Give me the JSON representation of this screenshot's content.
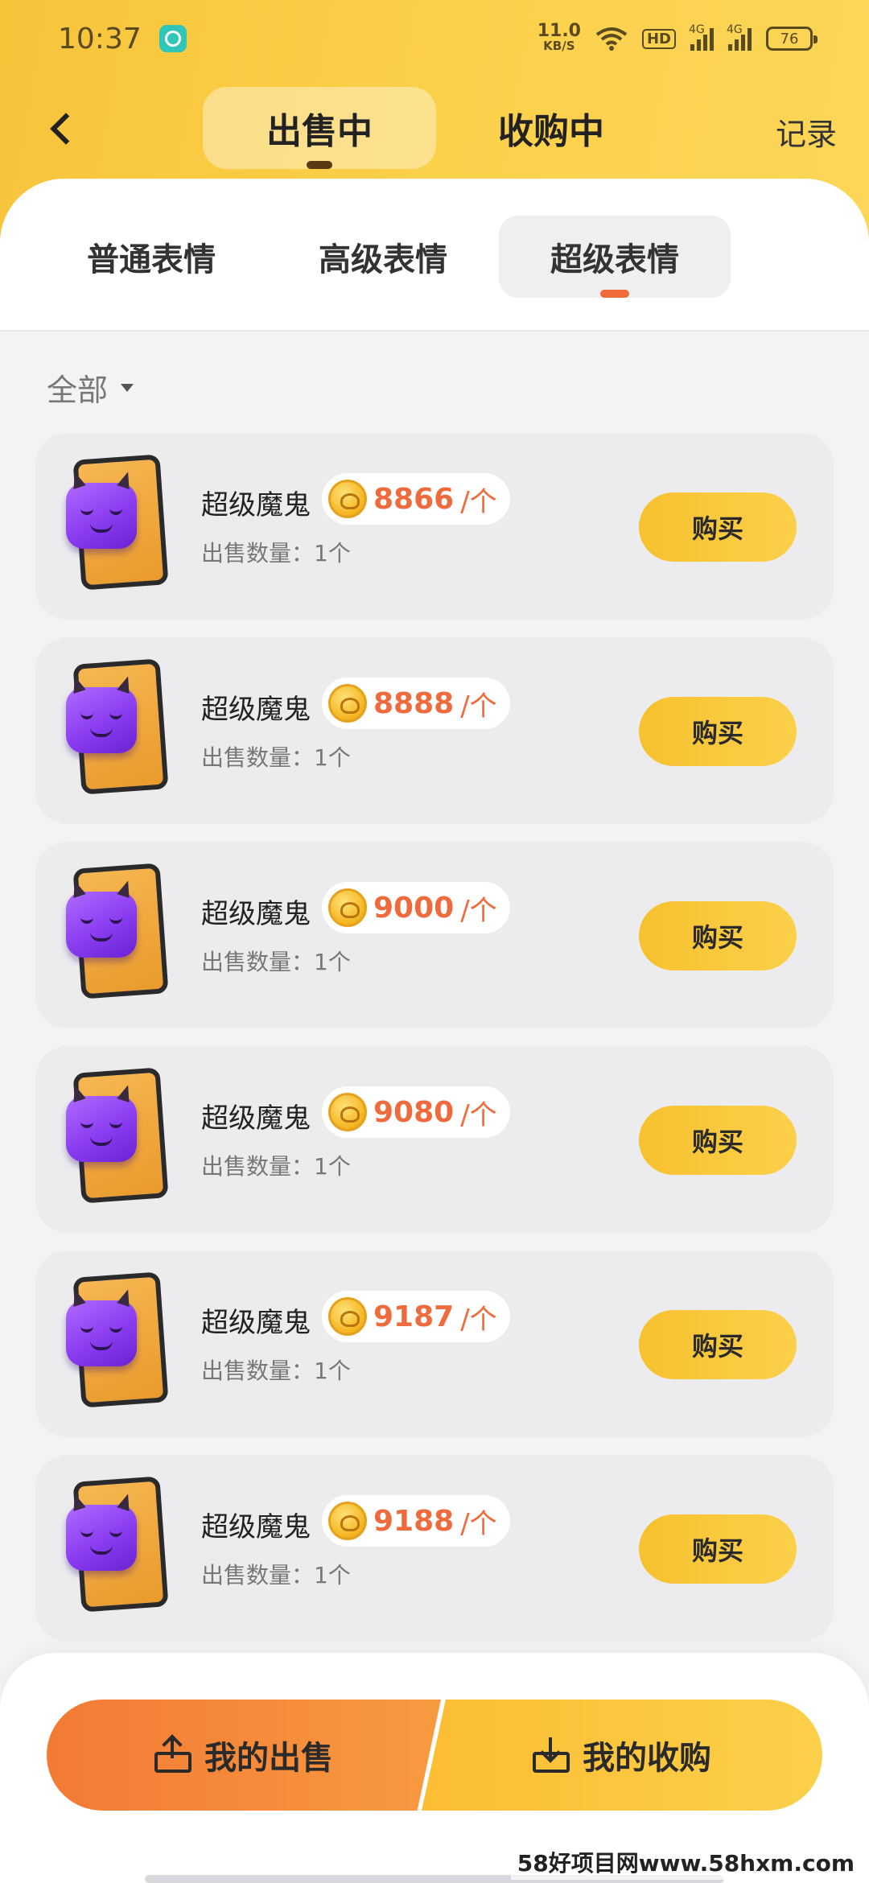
{
  "status_bar": {
    "time": "10:37",
    "net_speed_value": "11.0",
    "net_speed_unit": "KB/S",
    "hd_label": "HD",
    "signal_1_label": "4G",
    "signal_2_label": "4G",
    "battery": "76"
  },
  "nav": {
    "tabs": [
      {
        "label": "出售中",
        "active": true
      },
      {
        "label": "收购中",
        "active": false
      }
    ],
    "record_label": "记录"
  },
  "sub_tabs": [
    {
      "label": "普通表情",
      "active": false
    },
    {
      "label": "高级表情",
      "active": false
    },
    {
      "label": "超级表情",
      "active": true
    }
  ],
  "filter": {
    "label": "全部"
  },
  "listings": [
    {
      "name": "超级魔鬼",
      "price": "8866",
      "unit": "/个",
      "qty": "出售数量：1个",
      "button": "购买"
    },
    {
      "name": "超级魔鬼",
      "price": "8888",
      "unit": "/个",
      "qty": "出售数量：1个",
      "button": "购买"
    },
    {
      "name": "超级魔鬼",
      "price": "9000",
      "unit": "/个",
      "qty": "出售数量：1个",
      "button": "购买"
    },
    {
      "name": "超级魔鬼",
      "price": "9080",
      "unit": "/个",
      "qty": "出售数量：1个",
      "button": "购买"
    },
    {
      "name": "超级魔鬼",
      "price": "9187",
      "unit": "/个",
      "qty": "出售数量：1个",
      "button": "购买"
    },
    {
      "name": "超级魔鬼",
      "price": "9188",
      "unit": "/个",
      "qty": "出售数量：1个",
      "button": "购买"
    }
  ],
  "bottom_actions": {
    "sell_label": "我的出售",
    "buy_label": "我的收购"
  },
  "watermark": "58好项目网www.58hxm.com",
  "colors": {
    "header_yellow": "#fbd04a",
    "price_orange": "#ee6b3d",
    "tab_indicator": "#f06a3a",
    "sell_button": "#f27a35",
    "buy_button": "#fbbd33"
  }
}
